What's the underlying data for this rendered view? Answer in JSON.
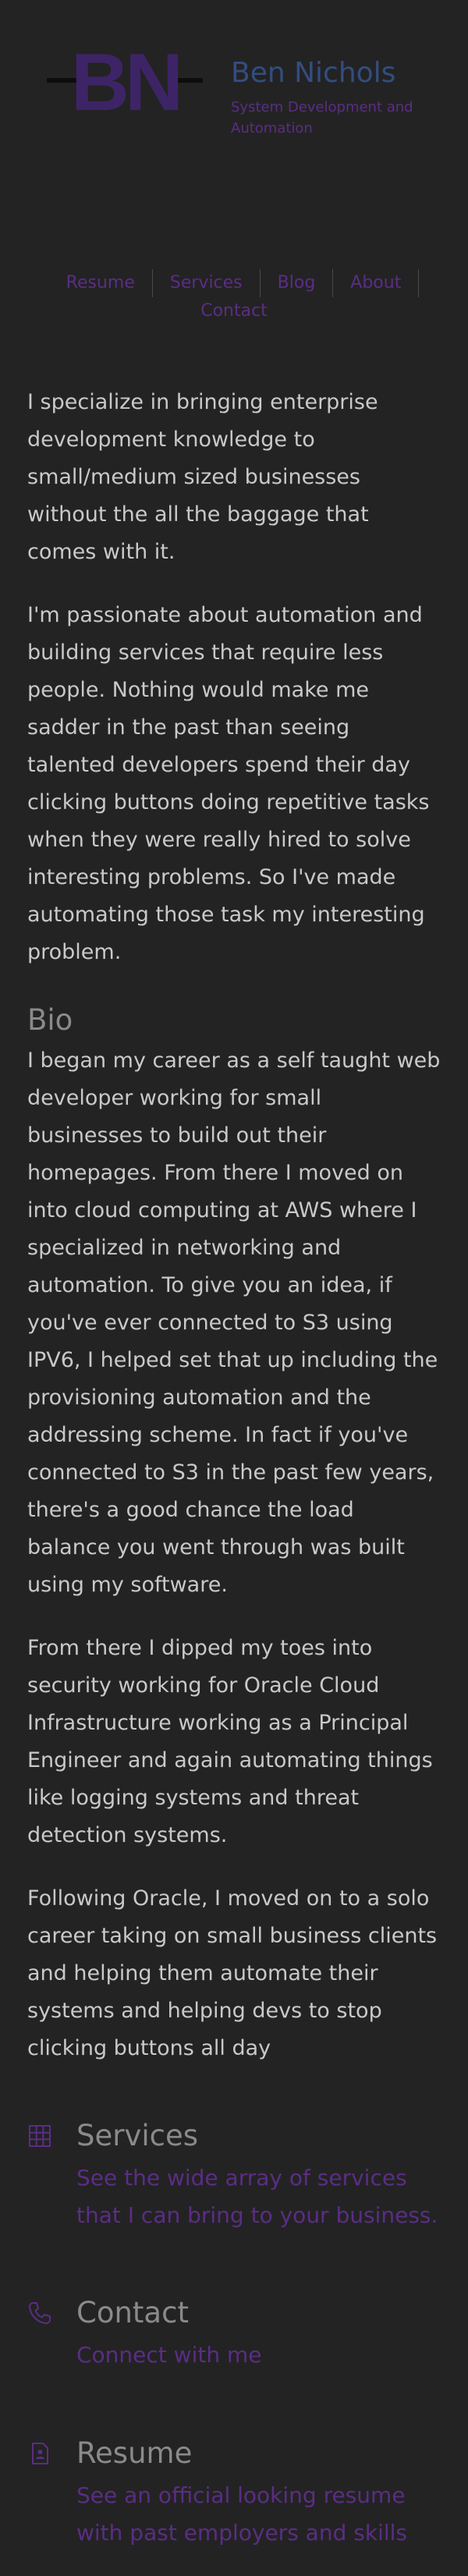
{
  "header": {
    "title": "Ben Nichols",
    "tagline": "System Development and Automation",
    "logo_letters": "BN"
  },
  "nav": {
    "items": [
      {
        "label": "Resume"
      },
      {
        "label": "Services"
      },
      {
        "label": "Blog"
      },
      {
        "label": "About"
      },
      {
        "label": "Contact"
      }
    ]
  },
  "content": {
    "intro": [
      "I specialize in bringing enterprise development knowledge to small/medium sized businesses without the all the baggage that comes with it.",
      "I'm passionate about automation and building services that require less people. Nothing would make me sadder in the past than seeing talented developers spend their day clicking buttons doing repetitive tasks when they were really hired to solve interesting problems. So I've made automating those task my interesting problem."
    ],
    "bio_heading": "Bio",
    "bio": [
      "I began my career as a self taught web developer working for small businesses to build out their homepages. From there I moved on into cloud computing at AWS where I specialized in networking and automation. To give you an idea, if you've ever connected to S3 using IPV6, I helped set that up including the provisioning automation and the addressing scheme. In fact if you've connected to S3 in the past few years, there's a good chance the load balance you went through was built using my software.",
      "From there I dipped my toes into security working for Oracle Cloud Infrastructure working as a Principal Engineer and again automating things like logging systems and threat detection systems.",
      "Following Oracle, I moved on to a solo career taking on small business clients and helping them automate their systems and helping devs to stop clicking buttons all day"
    ]
  },
  "cards": {
    "services": {
      "title": "Services",
      "text": "See the wide array of services that I can bring to your business.",
      "icon": "grid-icon"
    },
    "contact": {
      "title": "Contact",
      "text": "Connect with me",
      "icon": "phone-icon"
    },
    "resume": {
      "title": "Resume",
      "text": "See an official looking resume with past employers and skills",
      "icon": "document-icon"
    }
  },
  "colors": {
    "background": "#232323",
    "title_blue": "#334d80",
    "accent_purple": "#5b2d85",
    "body_text": "#c9c9c9",
    "heading_gray": "#8a8a8a"
  }
}
